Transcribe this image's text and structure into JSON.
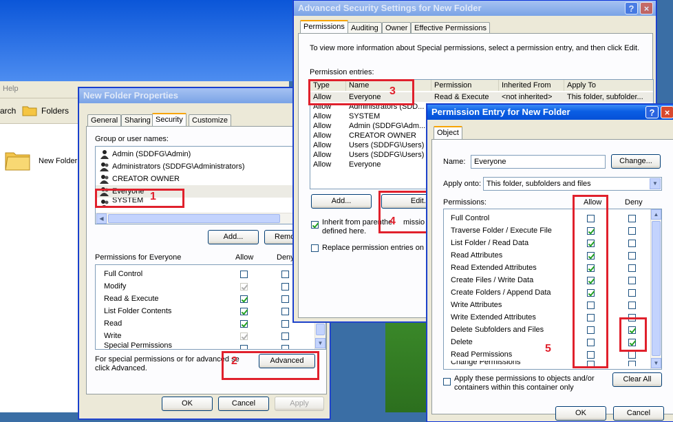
{
  "explorer": {
    "menu_help": "Help",
    "toolbar_search": "arch",
    "toolbar_folders": "Folders",
    "item_label": "New Folder"
  },
  "props_dialog": {
    "title": "New Folder Properties",
    "tabs": [
      "General",
      "Sharing",
      "Security",
      "Customize"
    ],
    "group_label": "Group or user names:",
    "users": [
      "Admin (SDDFG\\Admin)",
      "Administrators (SDDFG\\Administrators)",
      "CREATOR OWNER",
      "Everyone",
      "SYSTEM"
    ],
    "add_button": "Add...",
    "remove_button": "Remo",
    "permissions_label": "Permissions for Everyone",
    "allow_header": "Allow",
    "deny_header": "Deny",
    "permissions": [
      {
        "name": "Full Control",
        "allow": false,
        "allow_gray": false,
        "deny": false
      },
      {
        "name": "Modify",
        "allow": true,
        "allow_gray": true,
        "deny": false
      },
      {
        "name": "Read & Execute",
        "allow": true,
        "allow_gray": false,
        "deny": false
      },
      {
        "name": "List Folder Contents",
        "allow": true,
        "allow_gray": false,
        "deny": false
      },
      {
        "name": "Read",
        "allow": true,
        "allow_gray": false,
        "deny": false
      },
      {
        "name": "Write",
        "allow": true,
        "allow_gray": true,
        "deny": false
      },
      {
        "name": "Special Permissions",
        "allow": false,
        "allow_gray": false,
        "deny": false
      }
    ],
    "advanced_text": "For special permissions or for advanced se",
    "advanced_text2": "click Advanced.",
    "advanced_button": "Advanced",
    "ok_button": "OK",
    "cancel_button": "Cancel",
    "apply_button": "Apply"
  },
  "adv_dialog": {
    "title": "Advanced Security Settings for New Folder",
    "tabs": [
      "Permissions",
      "Auditing",
      "Owner",
      "Effective Permissions"
    ],
    "info_text": "To view more information about Special permissions, select a permission entry, and then click Edit.",
    "entries_label": "Permission entries:",
    "columns": [
      "Type",
      "Name",
      "Permission",
      "Inherited From",
      "Apply To"
    ],
    "entries": [
      {
        "type": "Allow",
        "name": "Everyone",
        "permission": "Read & Execute",
        "inherited": "<not inherited>",
        "apply_to": "This folder, subfolder..."
      },
      {
        "type": "Allow",
        "name": "Administrators (SDD...",
        "permission": "",
        "inherited": "",
        "apply_to": ""
      },
      {
        "type": "Allow",
        "name": "SYSTEM",
        "permission": "",
        "inherited": "",
        "apply_to": ""
      },
      {
        "type": "Allow",
        "name": "Admin (SDDFG\\Adm...",
        "permission": "",
        "inherited": "",
        "apply_to": ""
      },
      {
        "type": "Allow",
        "name": "CREATOR OWNER",
        "permission": "",
        "inherited": "",
        "apply_to": ""
      },
      {
        "type": "Allow",
        "name": "Users (SDDFG\\Users)",
        "permission": "",
        "inherited": "",
        "apply_to": ""
      },
      {
        "type": "Allow",
        "name": "Users (SDDFG\\Users)",
        "permission": "",
        "inherited": "",
        "apply_to": ""
      },
      {
        "type": "Allow",
        "name": "Everyone",
        "permission": "",
        "inherited": "",
        "apply_to": ""
      }
    ],
    "add_button": "Add...",
    "edit_button": "Edit...",
    "inherit_text": "Inherit from paren",
    "inherit_text_b": "the",
    "inherit_text_c": "missio",
    "inherit_text2": "defined here.",
    "replace_text": "Replace permission entries on al"
  },
  "entry_dialog": {
    "title": "Permission Entry for New Folder",
    "tab": "Object",
    "name_label": "Name:",
    "name_value": "Everyone",
    "change_button": "Change...",
    "apply_onto_label": "Apply onto:",
    "apply_onto_value": "This folder, subfolders and files",
    "permissions_label": "Permissions:",
    "allow_header": "Allow",
    "deny_header": "Deny",
    "permissions": [
      {
        "name": "Full Control",
        "allow": false,
        "deny": false
      },
      {
        "name": "Traverse Folder / Execute File",
        "allow": true,
        "deny": false
      },
      {
        "name": "List Folder / Read Data",
        "allow": true,
        "deny": false
      },
      {
        "name": "Read Attributes",
        "allow": true,
        "deny": false
      },
      {
        "name": "Read Extended Attributes",
        "allow": true,
        "deny": false
      },
      {
        "name": "Create Files / Write Data",
        "allow": true,
        "deny": false
      },
      {
        "name": "Create Folders / Append Data",
        "allow": true,
        "deny": false
      },
      {
        "name": "Write Attributes",
        "allow": false,
        "deny": false
      },
      {
        "name": "Write Extended Attributes",
        "allow": false,
        "deny": false
      },
      {
        "name": "Delete Subfolders and Files",
        "allow": false,
        "deny": true
      },
      {
        "name": "Delete",
        "allow": false,
        "deny": true
      },
      {
        "name": "Read Permissions",
        "allow": false,
        "deny": false
      },
      {
        "name": "Change Permissions",
        "allow": false,
        "deny": false
      }
    ],
    "apply_text": "Apply these permissions to objects and/or",
    "apply_text2": "containers within this container only",
    "clear_all_button": "Clear All",
    "ok_button": "OK",
    "cancel_button": "Cancel"
  },
  "annotations": [
    "1",
    "2",
    "3",
    "4",
    "5"
  ],
  "colors": {
    "highlight": "#e0202c",
    "titlebar": "#0a5ee4",
    "check": "#21a121"
  }
}
